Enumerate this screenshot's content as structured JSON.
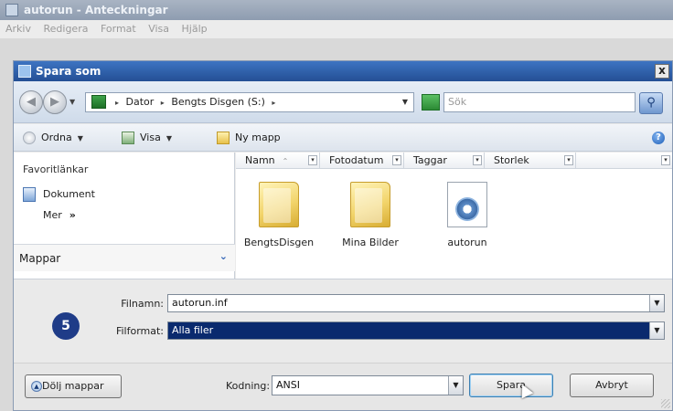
{
  "notepad": {
    "title": "autorun - Anteckningar",
    "menu": [
      "Arkiv",
      "Redigera",
      "Format",
      "Visa",
      "Hjälp"
    ]
  },
  "dialog": {
    "title": "Spara som",
    "close": "x"
  },
  "address": {
    "crumbs": [
      "Dator",
      "Bengts Disgen (S:)"
    ],
    "search_placeholder": "Sök"
  },
  "toolbar": {
    "organize": "Ordna",
    "views": "Visa",
    "new_folder": "Ny mapp",
    "help": "?"
  },
  "navpane": {
    "favorites_heading": "Favoritlänkar",
    "items": [
      "Dokument"
    ],
    "more": "Mer",
    "more_chevron": "»",
    "folders": "Mappar",
    "folders_chevron": "⌄"
  },
  "columns": [
    "Namn",
    "Fotodatum",
    "Taggar",
    "Storlek"
  ],
  "files": [
    {
      "name": "BengtsDisgen",
      "icon": "folder-icon"
    },
    {
      "name": "Mina Bilder",
      "icon": "folder-icon"
    },
    {
      "name": "autorun",
      "icon": "inf-file-icon"
    }
  ],
  "form": {
    "filename_label": "Filnamn:",
    "filename_value": "autorun.inf",
    "filetype_label": "Filformat:",
    "filetype_value": "Alla filer",
    "step_badge": "5"
  },
  "bottom": {
    "hide_folders": "Dölj mappar",
    "encoding_label": "Kodning:",
    "encoding_value": "ANSI",
    "save": "Spara",
    "cancel": "Avbryt"
  }
}
